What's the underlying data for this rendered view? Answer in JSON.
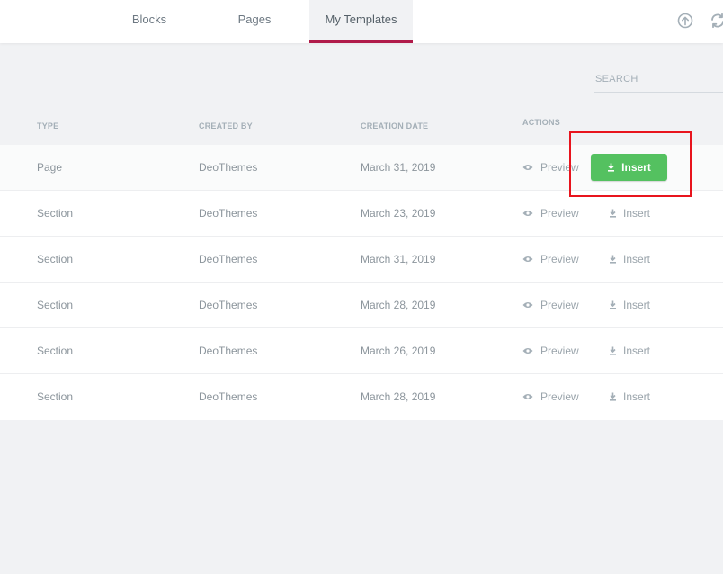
{
  "tabs": [
    {
      "label": "Blocks",
      "active": false
    },
    {
      "label": "Pages",
      "active": false
    },
    {
      "label": "My Templates",
      "active": true
    }
  ],
  "toolbar_icons": [
    "upload-icon",
    "sync-icon"
  ],
  "search": {
    "placeholder": "SEARCH",
    "value": ""
  },
  "table": {
    "headers": {
      "type": "TYPE",
      "created_by": "CREATED BY",
      "creation_date": "CREATION DATE",
      "actions": "ACTIONS"
    },
    "action_labels": {
      "preview": "Preview",
      "insert": "Insert"
    },
    "rows": [
      {
        "type": "Page",
        "created_by": "DeoThemes",
        "date": "March 31, 2019"
      },
      {
        "type": "Section",
        "created_by": "DeoThemes",
        "date": "March 23, 2019"
      },
      {
        "type": "Section",
        "created_by": "DeoThemes",
        "date": "March 31, 2019"
      },
      {
        "type": "Section",
        "created_by": "DeoThemes",
        "date": "March 28, 2019"
      },
      {
        "type": "Section",
        "created_by": "DeoThemes",
        "date": "March 26, 2019"
      },
      {
        "type": "Section",
        "created_by": "DeoThemes",
        "date": "March 28, 2019"
      }
    ]
  },
  "colors": {
    "accent_tab": "#b01b4a",
    "insert_button": "#54c160",
    "highlight_box": "#e8141d"
  }
}
